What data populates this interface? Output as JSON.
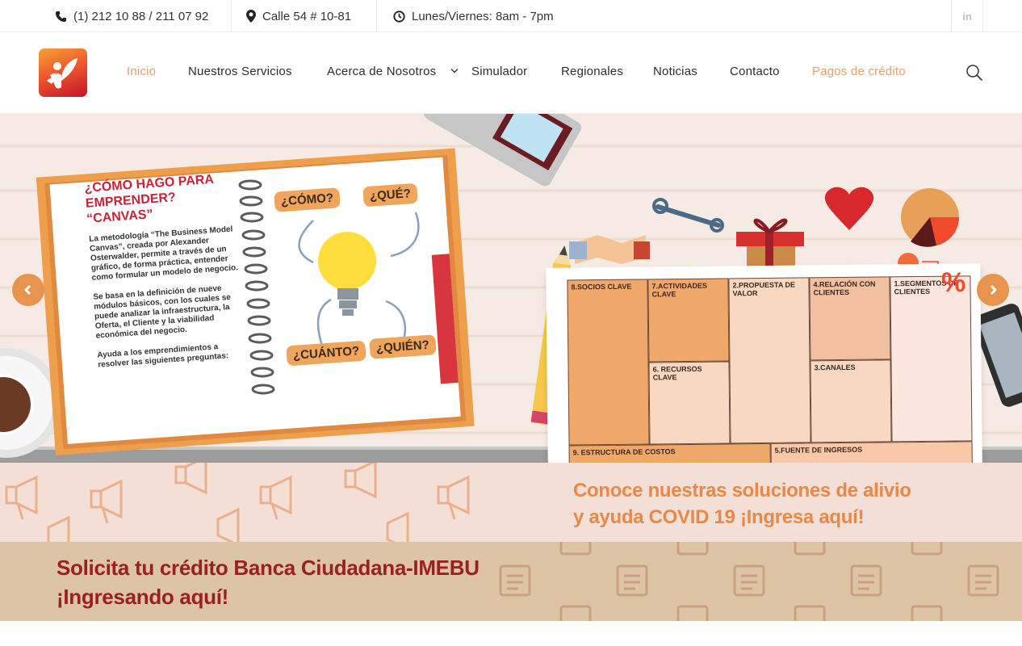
{
  "topbar": {
    "phone": "(1) 212 10 88 / 211 07 92",
    "address": "Calle 54 # 10-81",
    "hours": "Lunes/Viernes: 8am - 7pm",
    "social": "in",
    "icons": [
      "phone-icon",
      "map-pin-icon",
      "clock-icon",
      "linkedin-icon"
    ]
  },
  "nav": {
    "items": [
      {
        "label": "Inicio"
      },
      {
        "label": "Nuestros Servicios"
      },
      {
        "label": "Acerca de Nosotros"
      },
      {
        "label": "Simulador"
      },
      {
        "label": "Regionales"
      },
      {
        "label": "Noticias"
      },
      {
        "label": "Contacto"
      },
      {
        "label": "Pagos de crédito"
      }
    ],
    "active": "Inicio"
  },
  "slider": {
    "notebook": {
      "title": "¿CÓMO HAGO PARA EMPRENDER? “CANVAS”",
      "bullet1": "La metodología “The Business Model Canvas”, creada por Alexander Osterwalder, permite a través de un gráfico, de forma práctica, entender como formular un modelo de negocio.",
      "bullet2": "Se basa en la definición de nueve módulos básicos, con los cuales se puede analizar la infraestructura, la Oferta, el Cliente y la viabilidad económica del negocio.",
      "bullet3": "Ayuda a los emprendimientos a resolver las siguientes preguntas:",
      "q_como": "¿CÓMO?",
      "q_que": "¿QUÉ?",
      "q_cuanto": "¿CUÁNTO?",
      "q_quien": "¿QUIÉN?"
    },
    "canvas": {
      "socios": "8.SOCIOS CLAVE",
      "actividades": "7.ACTIVIDADES CLAVE",
      "propuesta": "2.PROPUESTA DE VALOR",
      "relacion": "4.RELACIÓN CON CLIENTES",
      "segmentos": "1.SEGMENTOS DE CLIENTES",
      "recursos": "6. RECURSOS CLAVE",
      "canales": "3.CANALES",
      "costos": "9. ESTRUCTURA DE COSTOS",
      "ingresos": "5.FUENTE DE INGRESOS",
      "percent": "%"
    }
  },
  "banner_covid": {
    "line1": "Conoce nuestras soluciones de alivio",
    "line2": "y ayuda COVID 19 ¡Ingresa aquí!"
  },
  "banner_credito": {
    "line1": "Solicita tu crédito Banca Ciudadana-IMEBU",
    "line2": "¡Ingresando aquí!"
  },
  "colors": {
    "accent": "#e3a06a",
    "arrow": "#e8944e",
    "covid_text": "#e88849",
    "credito_text": "#9a2021"
  }
}
